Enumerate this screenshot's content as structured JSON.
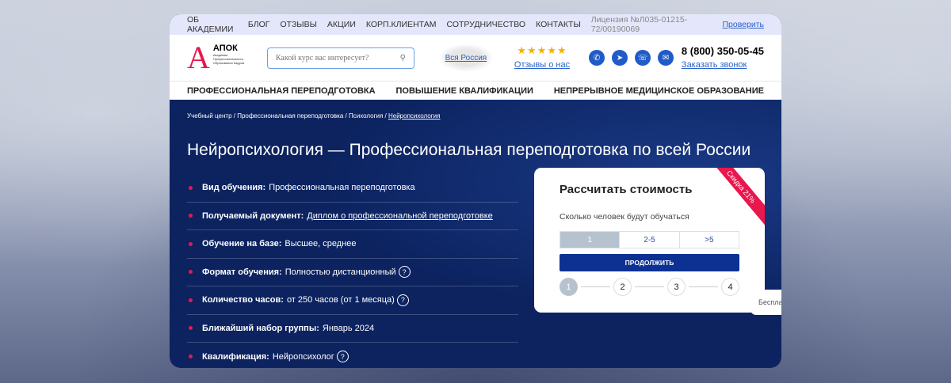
{
  "topbar": {
    "menu": [
      "ОБ АКАДЕМИИ",
      "БЛОГ",
      "ОТЗЫВЫ",
      "АКЦИИ",
      "КОРП.КЛИЕНТАМ",
      "СОТРУДНИЧЕСТВО",
      "КОНТАКТЫ"
    ],
    "license": "Лицензия №Л035-01215-72/00190069",
    "verify": "Проверить"
  },
  "header": {
    "logo_letter": "А",
    "logo_name": "АПОК",
    "logo_sub": "Академии Профессионального Образования Кадров",
    "search_placeholder": "Какой курс вас интересует?",
    "region": "Вся Россия",
    "stars": "★★★★★",
    "reviews": "Отзывы о нас",
    "phone": "8 (800) 350-05-45",
    "callback": "Заказать звонок"
  },
  "nav": [
    "ПРОФЕССИОНАЛЬНАЯ ПЕРЕПОДГОТОВКА",
    "ПОВЫШЕНИЕ КВАЛИФИКАЦИИ",
    "НЕПРЕРЫВНОЕ МЕДИЦИНСКОЕ ОБРАЗОВАНИЕ"
  ],
  "breadcrumb": [
    "Учебный центр",
    "Профессиональная переподготовка",
    "Психология",
    "Нейропсихология"
  ],
  "title": "Нейропсихология — Профессиональная переподготовка по всей России",
  "facts": [
    {
      "label": "Вид обучения:",
      "value": "Профессиональная переподготовка"
    },
    {
      "label": "Получаемый документ:",
      "value": "Диплом о профессиональной переподготовке"
    },
    {
      "label": "Обучение на базе:",
      "value": "Высшее, среднее"
    },
    {
      "label": "Формат обучения:",
      "value": "Полностью дистанционный"
    },
    {
      "label": "Количество часов:",
      "value": "от 250 часов (от 1 месяца)"
    },
    {
      "label": "Ближайший набор группы:",
      "value": "Январь 2024"
    },
    {
      "label": "Квалификация:",
      "value": "Нейропсихолог"
    }
  ],
  "calc": {
    "title": "Рассчитать стоимость",
    "discount": "Скидка 21%",
    "question": "Сколько человек будут обучаться",
    "options": [
      "1",
      "2-5",
      ">5"
    ],
    "selected": "1",
    "continue": "ПРОДОЛЖИТЬ",
    "steps": [
      "1",
      "2",
      "3",
      "4"
    ],
    "current_step": 1
  },
  "free_tab": "Бесплатная консультация",
  "help": "?"
}
